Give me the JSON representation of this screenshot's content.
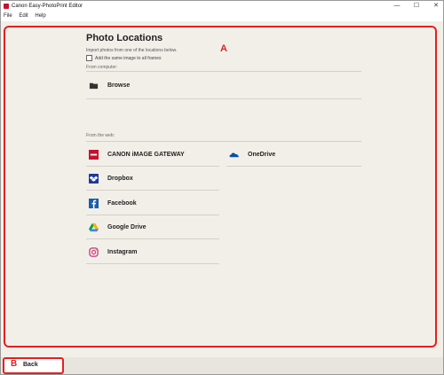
{
  "window": {
    "title": "Canon Easy-PhotoPrint Editor",
    "controls": {
      "minimize": "—",
      "maximize": "☐",
      "close": "✕"
    }
  },
  "menubar": {
    "items": [
      "File",
      "Edit",
      "Help"
    ]
  },
  "callouts": {
    "a": "A",
    "b": "B"
  },
  "main": {
    "title": "Photo Locations",
    "subtitle": "Import photos from one of the locations below.",
    "checkbox_label": "Add the same image to all frames",
    "checkbox_checked": false,
    "from_computer_label": "From computer:",
    "browse_label": "Browse",
    "from_web_label": "From the web:",
    "web_sources": [
      {
        "label": "CANON iMAGE GATEWAY",
        "icon": "canon-image-gateway-icon"
      },
      {
        "label": "OneDrive",
        "icon": "onedrive-icon"
      },
      {
        "label": "Dropbox",
        "icon": "dropbox-icon"
      },
      {
        "label": "Facebook",
        "icon": "facebook-icon"
      },
      {
        "label": "Google Drive",
        "icon": "google-drive-icon"
      },
      {
        "label": "Instagram",
        "icon": "instagram-icon"
      }
    ]
  },
  "footer": {
    "back_label": "Back"
  },
  "colors": {
    "callout_red": "#e5201f",
    "content_bg": "#f2efe9"
  }
}
